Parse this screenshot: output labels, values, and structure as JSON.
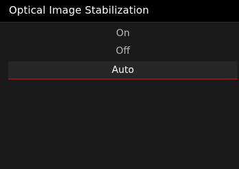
{
  "header": {
    "title": "Optical Image Stabilization"
  },
  "menu": {
    "options": [
      {
        "label": "On",
        "selected": false
      },
      {
        "label": "Off",
        "selected": false
      },
      {
        "label": "Auto",
        "selected": true
      }
    ]
  },
  "colors": {
    "background": "#161616",
    "title_bar": "#000000",
    "highlight_row": "#262626",
    "selection_underline": "#8c1c1c",
    "text_inactive": "#b9b9b9",
    "text_active": "#ffffff"
  }
}
